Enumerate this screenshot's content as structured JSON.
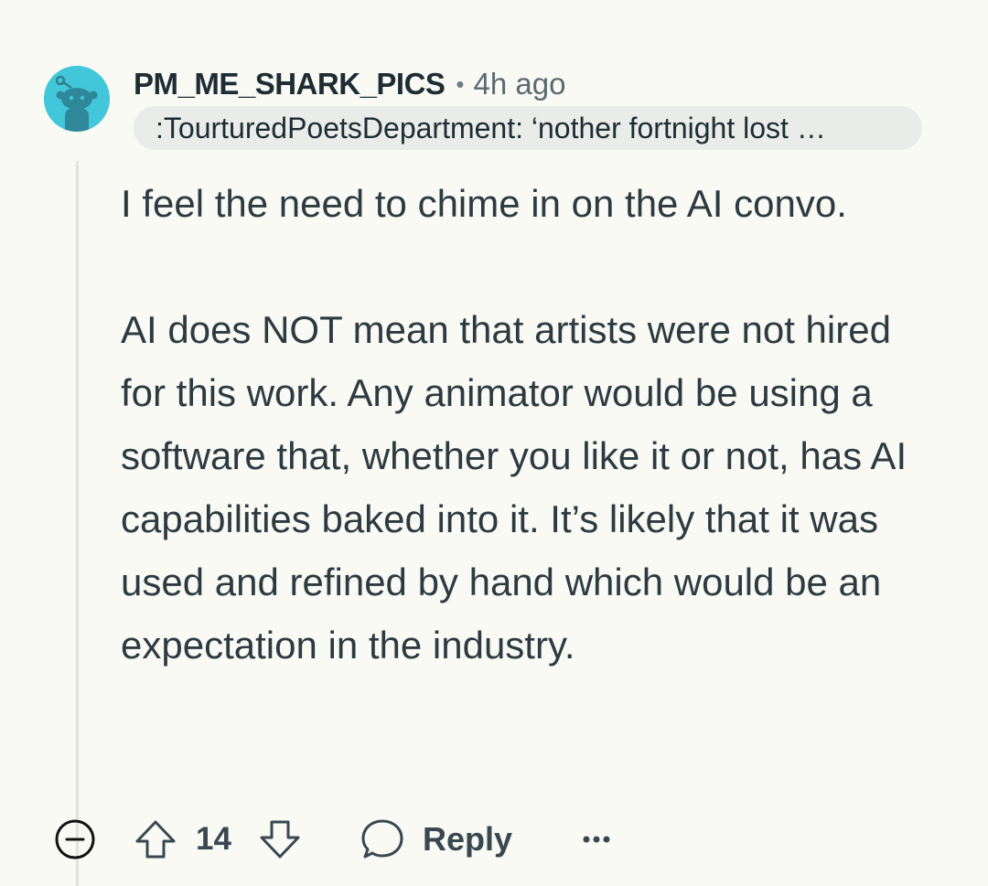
{
  "comment": {
    "username": "PM_ME_SHARK_PICS",
    "separator": "•",
    "timestamp": "4h ago",
    "flair": ":TourturedPoetsDepartment: ‘nother fortnight lost …",
    "paragraphs": [
      "I feel the need to chime in on the AI convo.",
      "AI does NOT mean that artists were not hired for this work. Any animator would be using a software that, whether you like it or not, has AI capabilities baked into it. It’s likely that it was used and refined by hand which would be an expectation in the industry."
    ],
    "vote_count": "14",
    "reply_label": "Reply",
    "icons": {
      "avatar": "snoo-avatar-icon",
      "collapse": "minus-circle-icon",
      "upvote": "arrow-up-icon",
      "downvote": "arrow-down-icon",
      "reply": "speech-bubble-icon",
      "more": "more-dots-icon"
    }
  },
  "colors": {
    "background": "#f8faf3",
    "avatar": "#41c7d9",
    "flair_background": "#e9ece8",
    "text": "#2d3a41",
    "muted": "#5c6a70"
  }
}
